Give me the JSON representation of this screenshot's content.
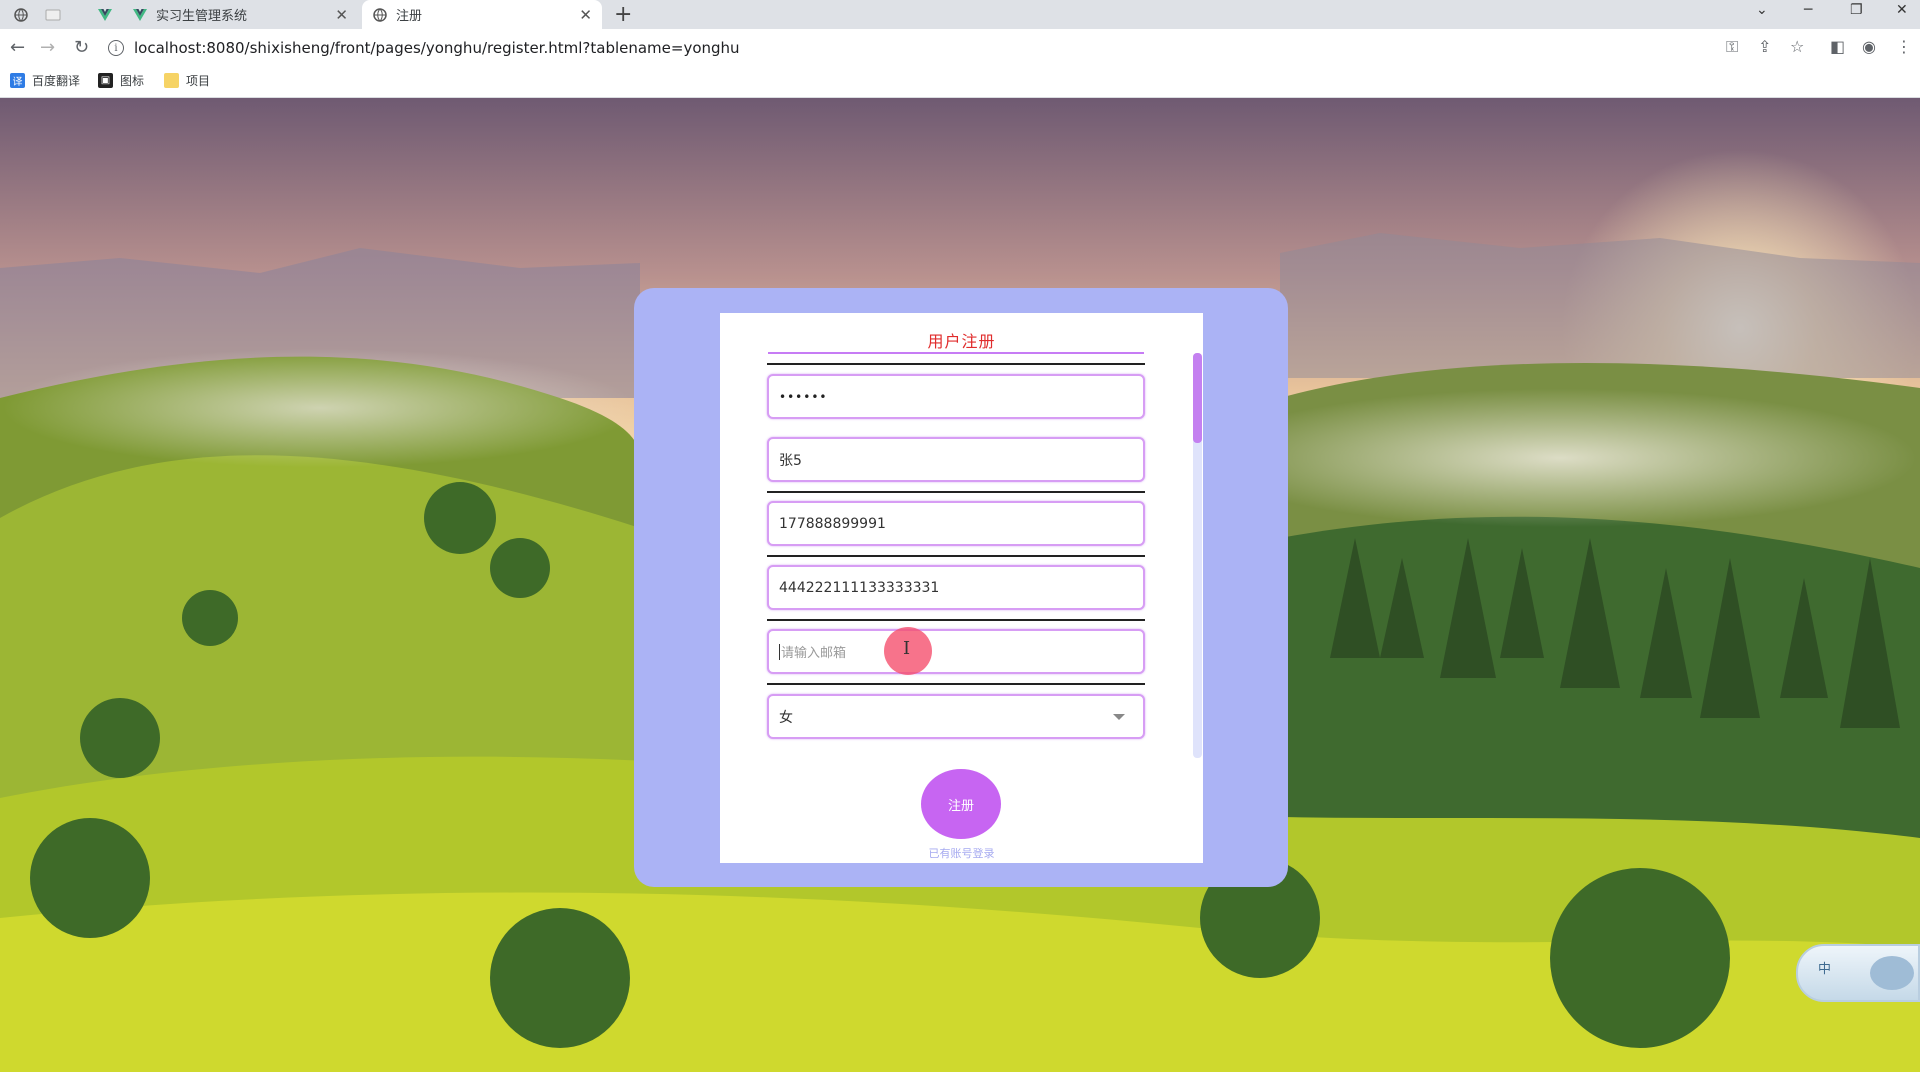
{
  "browser": {
    "tabs": [
      {
        "label": "实习生管理系统",
        "active": false
      },
      {
        "label": "注册",
        "active": true
      }
    ],
    "new_tab": "+",
    "url": "localhost:8080/shixisheng/front/pages/yonghu/register.html?tablename=yonghu",
    "bookmarks": [
      {
        "label": "百度翻译",
        "icon": "translate-icon"
      },
      {
        "label": "图标",
        "icon": "image-icon"
      },
      {
        "label": "项目",
        "icon": "folder-icon"
      }
    ]
  },
  "form": {
    "title": "用户注册",
    "password_value": "••••••",
    "name_value": "张5",
    "phone_value": "177888899991",
    "id_number_value": "444222111133333331",
    "email_placeholder": "请输入邮箱",
    "gender_value": "女",
    "register_button": "注册",
    "login_link": "已有账号登录"
  },
  "ime": {
    "label": "中"
  },
  "colors": {
    "card_outer": "#abb3f5",
    "accent_purple": "#c765f2",
    "title_red": "#e02c2c",
    "field_border": "#d79df4"
  }
}
